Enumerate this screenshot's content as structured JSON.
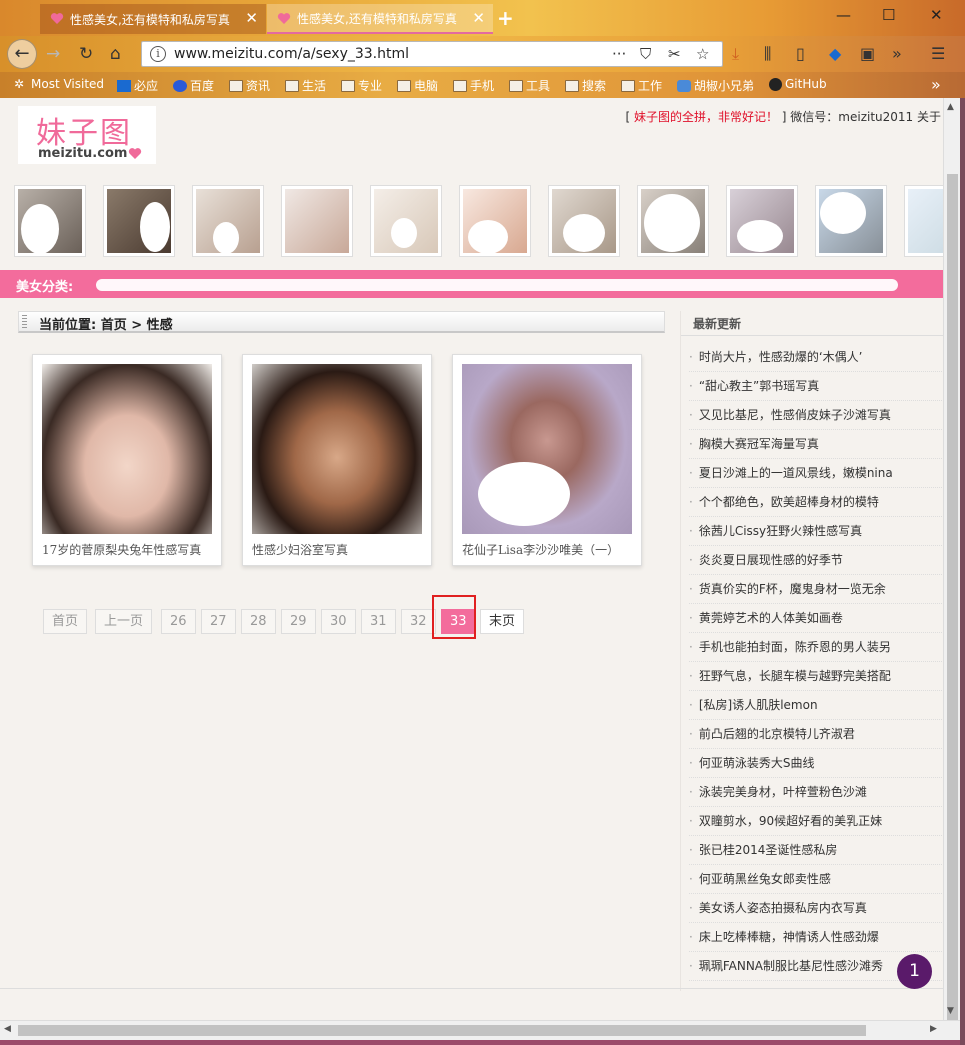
{
  "browser": {
    "tabs": [
      {
        "title": "性感美女,还有模特和私房写真"
      },
      {
        "title": "性感美女,还有模特和私房写真"
      }
    ],
    "new_tab": "+",
    "url": "www.meizitu.com/a/sexy_33.html",
    "url_actions": [
      "···",
      "⛉",
      "✂",
      "☆"
    ],
    "bookmarks": [
      {
        "label": "Most Visited"
      },
      {
        "label": "必应"
      },
      {
        "label": "百度"
      },
      {
        "label": "资讯"
      },
      {
        "label": "生活"
      },
      {
        "label": "专业"
      },
      {
        "label": "电脑"
      },
      {
        "label": "手机"
      },
      {
        "label": "工具"
      },
      {
        "label": "搜索"
      },
      {
        "label": "工作"
      },
      {
        "label": "胡椒小兄弟"
      },
      {
        "label": "GitHub"
      }
    ],
    "overflow": "»"
  },
  "site": {
    "logo_cn": "妹子图",
    "logo_en": "meizitu.com",
    "top_promo": "妹子图的全拼，非常好记！",
    "top_info_prefix": "[ ",
    "top_info_suffix": " ] 微信号：meizitu2011  关于",
    "category_label": "美女分类:",
    "breadcrumb": "当前位置:  首页 > 性感"
  },
  "gallery": [
    {
      "caption": "17岁的菅原梨央兔年性感写真"
    },
    {
      "caption": "性感少妇浴室写真"
    },
    {
      "caption": "花仙子Lisa李沙沙唯美（一）"
    }
  ],
  "pagination": {
    "first": "首页",
    "prev": "上一页",
    "pages": [
      "26",
      "27",
      "28",
      "29",
      "30",
      "31",
      "32"
    ],
    "current": "33",
    "last": "末页"
  },
  "sidebar": {
    "title": "最新更新",
    "items": [
      "时尚大片，性感劲爆的‘木偶人’",
      "“甜心教主”郭书瑶写真",
      "又见比基尼，性感俏皮妹子沙滩写真",
      "胸模大赛冠军海量写真",
      "夏日沙滩上的一道风景线，嫩模nina",
      "个个都绝色，欧美超棒身材的模特",
      "徐茜儿Cissy狂野火辣性感写真",
      "炎炎夏日展现性感的好季节",
      "货真价实的F杯，魔鬼身材一览无余",
      "黄莞婷艺术的人体美如画卷",
      "手机也能拍封面，陈乔恩的男人装另",
      "狂野气息，长腿车模与越野完美搭配",
      "[私房]诱人肌肤lemon",
      "前凸后翘的北京模特儿齐淑君",
      "何亚萌泳装秀大S曲线",
      "泳装完美身材，叶梓萱粉色沙滩",
      "双瞳剪水，90候超好看的美乳正妹",
      "张已桂2014圣诞性感私房",
      "何亚萌黑丝兔女郎卖性感",
      "美女诱人姿态拍摄私房内衣写真",
      "床上吃棒棒糖，神情诱人性感劲爆",
      "珮珮FANNA制服比基尼性感沙滩秀"
    ]
  },
  "badge": "1",
  "colors": {
    "accent": "#f36c9c",
    "highlight": "#e02020",
    "badge": "#5a1a6a"
  }
}
